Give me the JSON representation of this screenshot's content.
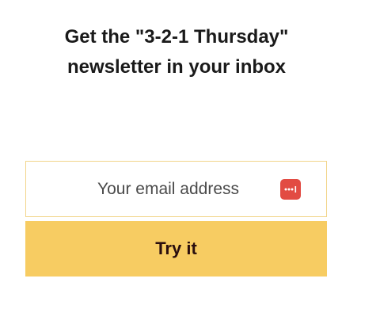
{
  "signup": {
    "heading_line1": "Get the \"3-2-1 Thursday\"",
    "heading_line2": "newsletter in your inbox",
    "email_placeholder": "Your email address",
    "email_value": "",
    "submit_label": "Try it",
    "password_manager_icon": "password-manager-icon"
  },
  "colors": {
    "accent": "#f7cc62",
    "input_border": "#f2d58a",
    "icon_red": "#e24b43",
    "button_text": "#2a0e0e"
  }
}
